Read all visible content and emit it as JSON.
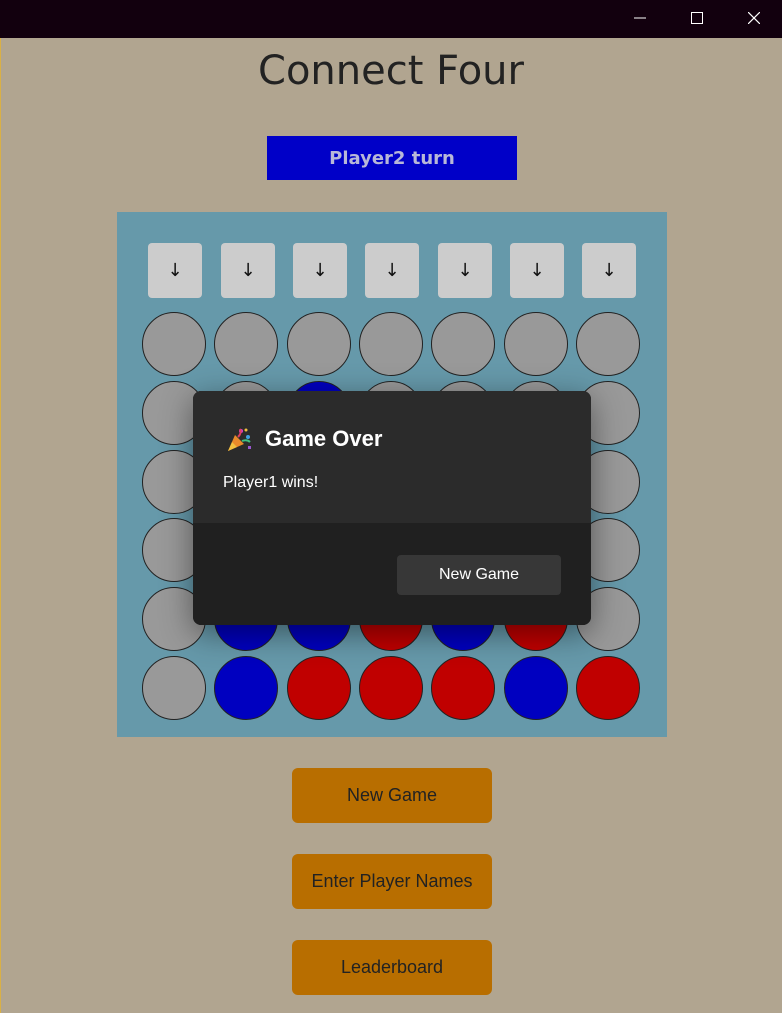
{
  "window": {
    "controls": {
      "minimize_icon": "minimize-icon",
      "maximize_icon": "maximize-icon",
      "close_icon": "close-icon"
    }
  },
  "app": {
    "title": "Connect Four",
    "turn_label": "Player2 turn"
  },
  "board": {
    "drop_symbol": "↓",
    "rows": [
      [
        "empty",
        "empty",
        "empty",
        "empty",
        "empty",
        "empty",
        "empty"
      ],
      [
        "empty",
        "empty",
        "blue",
        "empty",
        "empty",
        "empty",
        "empty"
      ],
      [
        "empty",
        "empty",
        "empty",
        "empty",
        "empty",
        "empty",
        "empty"
      ],
      [
        "empty",
        "empty",
        "empty",
        "empty",
        "empty",
        "empty",
        "empty"
      ],
      [
        "empty",
        "blue",
        "blue",
        "red",
        "blue",
        "red",
        "empty"
      ],
      [
        "empty",
        "blue",
        "red",
        "red",
        "red",
        "blue",
        "red"
      ]
    ],
    "colors": {
      "empty": "#999999",
      "blue": "#0000c0",
      "red": "#c00000",
      "board": "#6699aa"
    }
  },
  "dialog": {
    "icon": "party-popper-icon",
    "title": "Game Over",
    "message": "Player1 wins!",
    "button_label": "New Game"
  },
  "actions": {
    "new_game": "New Game",
    "enter_names": "Enter Player Names",
    "leaderboard": "Leaderboard"
  }
}
